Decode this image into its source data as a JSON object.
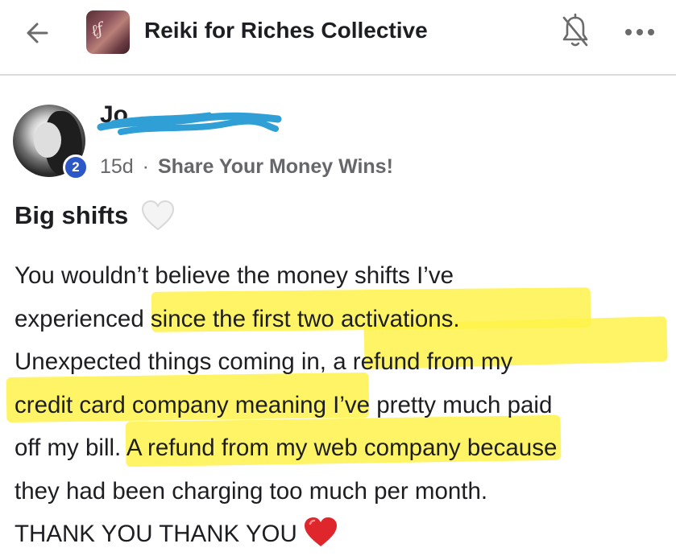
{
  "header": {
    "group_name": "Reiki for Riches Collective",
    "back_icon": "arrow-left-icon",
    "notification_icon": "bell-off-icon",
    "more_icon": "more-horizontal-icon"
  },
  "post": {
    "author_partial": "Jo",
    "badge_count": "2",
    "age": "15d",
    "separator": "·",
    "topic": "Share Your Money Wins!",
    "title": "Big shifts",
    "body_lines": [
      "You wouldn’t believe the money shifts I’ve",
      "experienced since the first two activations.",
      "Unexpected things coming in, a refund from my",
      "credit card company meaning I’ve pretty much paid",
      "off my bill. A refund from my web company because",
      "they had been charging too much per month.",
      "THANK YOU THANK YOU"
    ],
    "title_emoji": "white-heart-icon",
    "end_emoji": "red-heart-icon"
  },
  "colors": {
    "highlight": "#fff24a",
    "scribble": "#2f9fd6",
    "badge": "#2c58c7",
    "heart_red": "#e0262d"
  }
}
